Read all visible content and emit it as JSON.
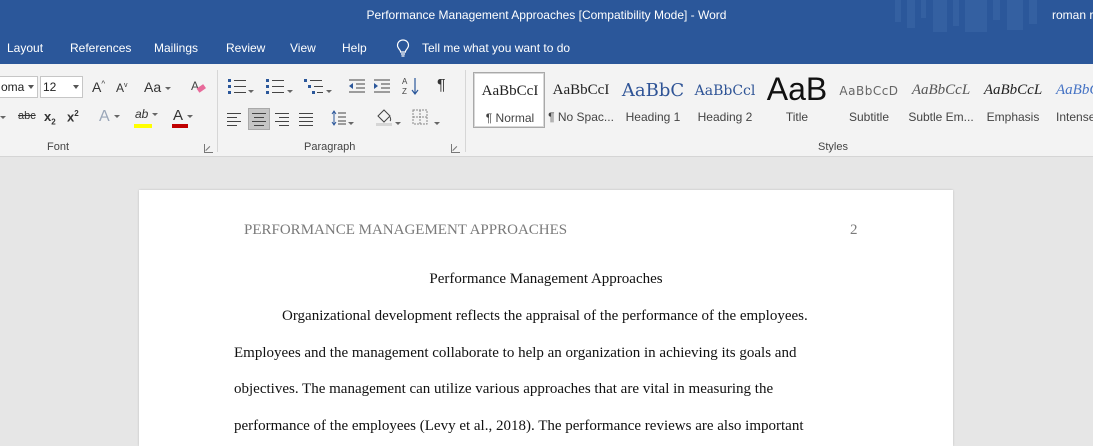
{
  "window": {
    "title": "Performance Management Approaches [Compatibility Mode]  -  Word",
    "user": "roman r"
  },
  "menu": {
    "tabs": [
      "Layout",
      "References",
      "Mailings",
      "Review",
      "View",
      "Help"
    ],
    "tell_me": "Tell me what you want to do"
  },
  "ribbon": {
    "font": {
      "name": "oma",
      "size": "12",
      "grow_label": "A",
      "shrink_label": "A",
      "case_label": "Aa",
      "strike_label": "abc",
      "sub_label": "x",
      "sub_mark": "2",
      "sup_label": "x",
      "sup_mark": "2",
      "effects_label": "A",
      "highlight_label": "ab",
      "color_label": "A",
      "group_label": "Font"
    },
    "paragraph": {
      "group_label": "Paragraph",
      "pilcrow": "¶"
    },
    "styles": {
      "group_label": "Styles",
      "items": [
        {
          "sample": "AaBbCcI",
          "name": "¶ Normal"
        },
        {
          "sample": "AaBbCcI",
          "name": "¶ No Spac..."
        },
        {
          "sample": "AaBbC",
          "name": "Heading 1"
        },
        {
          "sample": "AaBbCcl",
          "name": "Heading 2"
        },
        {
          "sample": "AaB",
          "name": "Title"
        },
        {
          "sample": "AaBbCcD",
          "name": "Subtitle"
        },
        {
          "sample": "AaBbCcL",
          "name": "Subtle Em..."
        },
        {
          "sample": "AaBbCcL",
          "name": "Emphasis"
        },
        {
          "sample": "AaBbC",
          "name": "Intense"
        }
      ]
    }
  },
  "colors": {
    "brand": "#2b579a",
    "highlight": "#ffff00",
    "font_color": "#c00000"
  },
  "document": {
    "header": "PERFORMANCE MANAGEMENT APPROACHES",
    "page_number": "2",
    "title": "Performance Management Approaches",
    "lines": [
      "Organizational development reflects the appraisal of the performance of the employees.",
      "Employees and the management collaborate to help an organization in achieving its goals and",
      "objectives. The management can utilize various approaches that are vital in measuring the",
      "performance of the employees (Levy et al., 2018). The performance reviews are also important"
    ]
  }
}
